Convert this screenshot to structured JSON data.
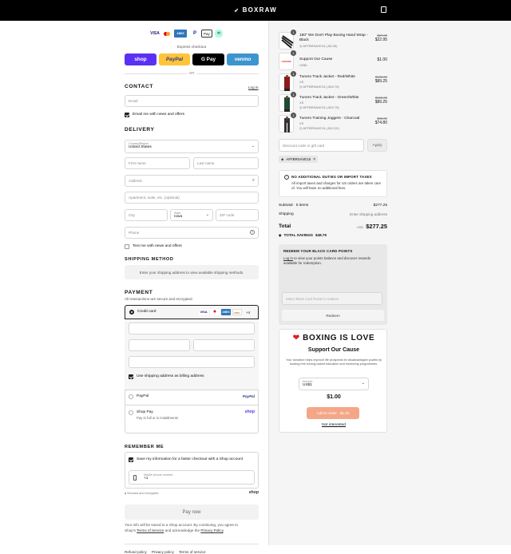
{
  "header": {
    "brand": "BOXRAW"
  },
  "express": {
    "label": "Express checkout",
    "or": "OR",
    "buttons": {
      "shop": "shop",
      "paypal": "PayPal",
      "gpay": "G Pay",
      "venmo": "venmo"
    }
  },
  "contact": {
    "title": "CONTACT",
    "login": "Log in",
    "email_placeholder": "Email",
    "news_label": "Email me with news and offers"
  },
  "delivery": {
    "title": "DELIVERY",
    "country_label": "Country/Region",
    "country_value": "United States",
    "first_name": "First name",
    "last_name": "Last name",
    "address": "Address",
    "apartment": "Apartment, suite, etc. (optional)",
    "city": "City",
    "state_label": "State",
    "state_value": "Iowa",
    "zip": "ZIP code",
    "phone": "Phone",
    "sms_label": "Text me with news and offers"
  },
  "shipping": {
    "title": "SHIPPING METHOD",
    "note": "Enter your shipping address to view available shipping methods."
  },
  "payment": {
    "title": "PAYMENT",
    "subtitle": "All transactions are secure and encrypted.",
    "credit_card": "Credit card",
    "more_cards": "+4",
    "billing_label": "Use shipping address as billing address",
    "paypal": "PayPal",
    "paypal_logo": "PayPal",
    "shoppay": "Shop Pay",
    "shoppay_sub": "Pay in full or in installments",
    "shop_logo": "shop"
  },
  "remember": {
    "title": "REMEMBER ME",
    "save_label": "Save my information for a faster checkout with a Shop account",
    "mobile_label": "Mobile phone number",
    "mobile_value": "+1",
    "secure": "Secured and encrypted",
    "shop_logo": "shop"
  },
  "pay_now": "Pay now",
  "legal": {
    "line1": "Your info will be saved to a Shop account. By continuing, you agree to",
    "line2a": "Shop's ",
    "terms": "Terms of Service",
    "line2b": " and acknowledge the ",
    "privacy": "Privacy Policy",
    "line2c": "."
  },
  "footer_links": [
    "Refund policy",
    "Privacy policy",
    "Terms of service"
  ],
  "cart": {
    "items": [
      {
        "qty": "1",
        "name": "180\" We Don't Play Boxing Hand Wrap - Black",
        "variant": "",
        "discount": "AFFBRSAVE15 (-$4.05)",
        "old_price": "$27.00",
        "price": "$22.95"
      },
      {
        "qty": "1",
        "name": "Support Our Cause",
        "variant": "US$1",
        "discount": "",
        "old_price": "",
        "price": "$1.00"
      },
      {
        "qty": "1",
        "name": "Tunero Track Jacket - Red/White",
        "variant": "XS",
        "discount": "AFFBRSAVE15 (-$15.75)",
        "old_price": "$105.00",
        "price": "$89.25"
      },
      {
        "qty": "1",
        "name": "Tunero Track Jacket - Green/White",
        "variant": "XS",
        "discount": "AFFBRSAVE15 (-$15.75)",
        "old_price": "$105.00",
        "price": "$89.25"
      },
      {
        "qty": "1",
        "name": "Tunero Training Joggers - Charcoal",
        "variant": "XS",
        "discount": "AFFBRSAVE15 (-$13.20)",
        "old_price": "$88.00",
        "price": "$74.80"
      }
    ],
    "discount_placeholder": "Discount code or gift card",
    "apply": "Apply",
    "applied_code": "AFFBRSAVE15",
    "duties_title": "NO ADDITIONAL DUTIES OR IMPORT TAXES",
    "duties_text": "All import taxes and charges for US orders are taken care of. You will have no additional fees.",
    "subtotal_label": "Subtotal · 5 items",
    "subtotal_value": "$277.25",
    "shipping_label": "Shipping",
    "shipping_value": "Enter shipping address",
    "total_label": "Total",
    "currency": "USD",
    "total_value": "$277.25",
    "savings_label": "TOTAL SAVINGS",
    "savings_value": "$48.75"
  },
  "points": {
    "title": "REDEEM YOUR BLACK CARD POINTS",
    "login": "Log in",
    "text": " to view your points balance and discover rewards available for redemption.",
    "placeholder": "Select Black Card Points to redeem",
    "button": "Redeem"
  },
  "cause": {
    "title": "BOXING IS LOVE",
    "subtitle": "Support Our Cause",
    "text": "Your donation helps improve life prospects for disadvantaged youths by funding free boxing-based education and mentoring programmes.",
    "amount_label": "Amount",
    "amount_value": "US$1",
    "price": "$1.00",
    "add_button": "Add to order · $1.00",
    "not_interested": "Not interested"
  },
  "colors": {
    "accent": "#5a31f4",
    "paypal": "#ffc439",
    "venmo": "#3d95ce",
    "orange": "#f4a787",
    "red": "#d8232a"
  }
}
